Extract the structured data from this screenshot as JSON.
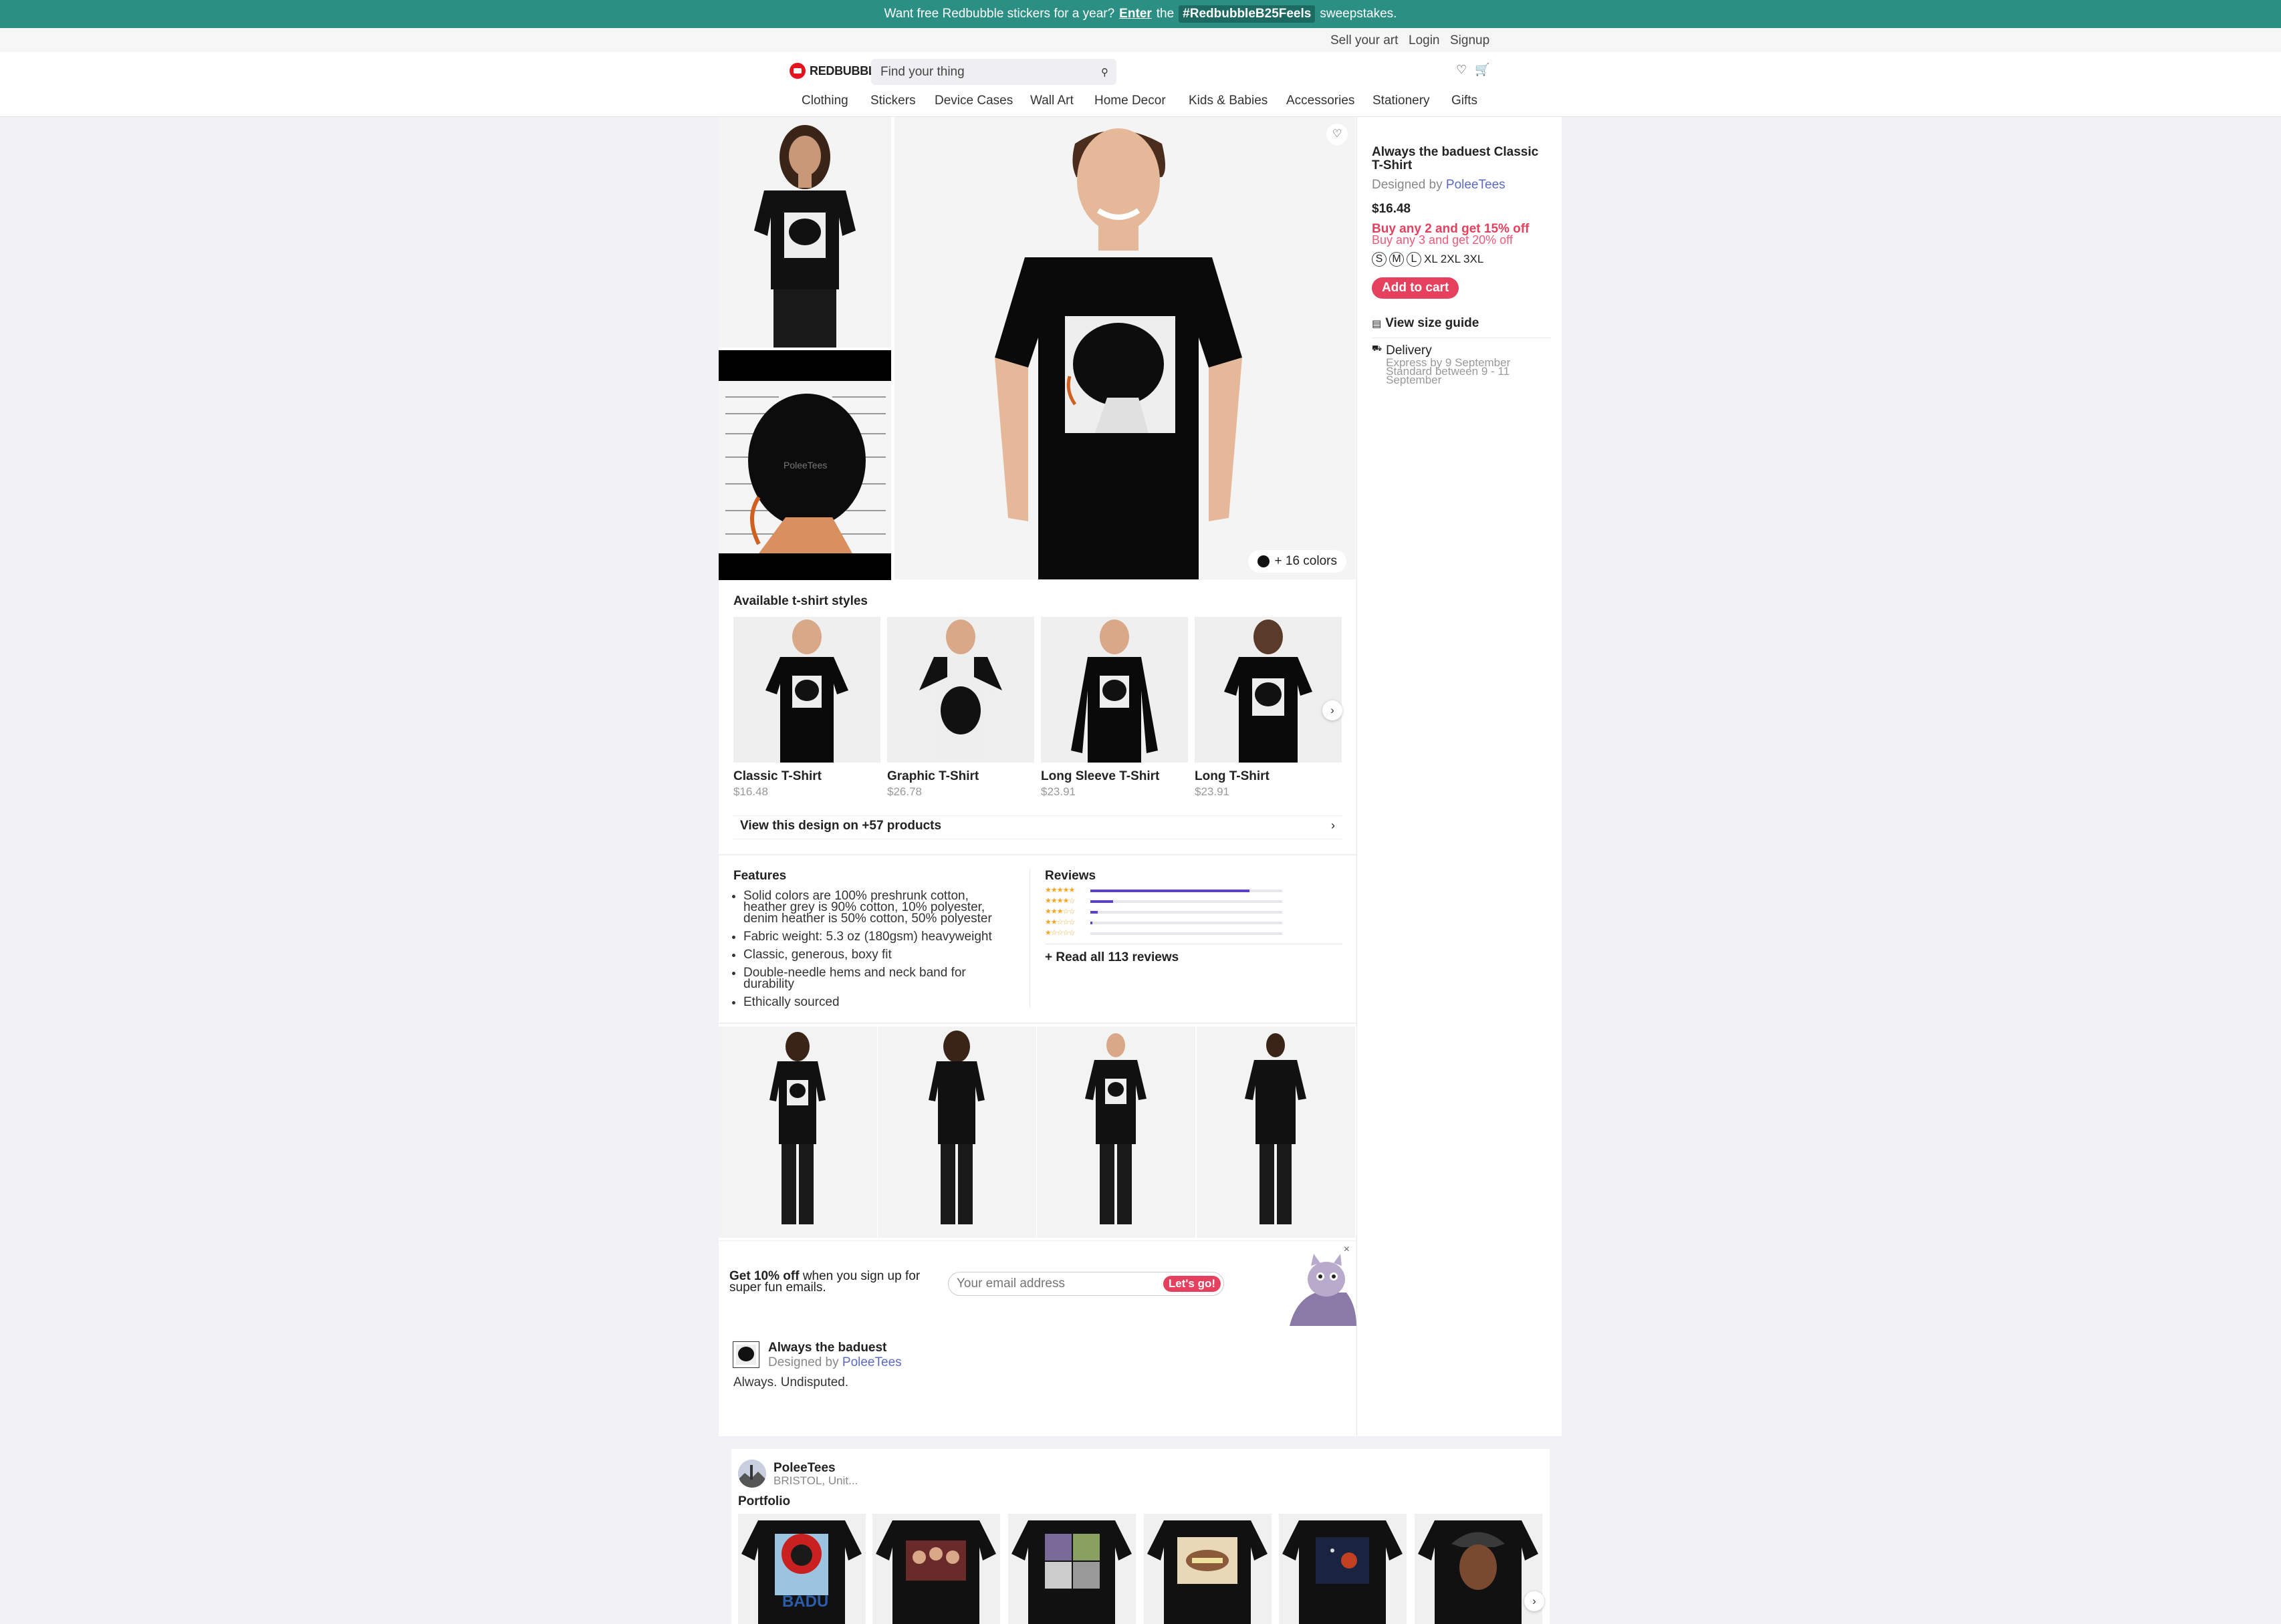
{
  "promo": {
    "pre": "Want free Redbubble stickers for a year?",
    "link": "Enter",
    "mid": "the",
    "tag": "#RedbubbleB25Feels",
    "post": "sweepstakes."
  },
  "util": {
    "sell": "Sell your art",
    "login": "Login",
    "signup": "Signup"
  },
  "header": {
    "logo": "REDBUBBLE",
    "search_placeholder": "Find your thing"
  },
  "nav": [
    "Clothing",
    "Stickers",
    "Device Cases",
    "Wall Art",
    "Home Decor",
    "Kids & Babies",
    "Accessories",
    "Stationery",
    "Gifts"
  ],
  "product": {
    "title": "Always the baduest Classic T-Shirt",
    "designed_by_prefix": "Designed by",
    "designer": "PoleeTees",
    "price": "$16.48",
    "promo1": "Buy any 2 and get 15% off",
    "promo2": "Buy any 3 and get 20% off",
    "sizes": [
      "S",
      "M",
      "L",
      "XL",
      "2XL",
      "3XL"
    ],
    "add_to_cart": "Add to cart",
    "size_guide": "View size guide",
    "delivery_title": "Delivery",
    "delivery_express": "Express by 9 September",
    "delivery_standard": "Standard between 9 - 11 September",
    "colors_label": "+ 16 colors",
    "watermark": "PoleeTees"
  },
  "styles": {
    "title": "Available t-shirt styles",
    "items": [
      {
        "name": "Classic T-Shirt",
        "price": "$16.48"
      },
      {
        "name": "Graphic T-Shirt",
        "price": "$26.78"
      },
      {
        "name": "Long Sleeve T-Shirt",
        "price": "$23.91"
      },
      {
        "name": "Long T-Shirt",
        "price": "$23.91"
      }
    ],
    "view_all": "View this design on +57 products"
  },
  "features": {
    "title": "Features",
    "items": [
      "Solid colors are 100% preshrunk cotton, heather grey is 90% cotton, 10% polyester, denim heather is 50% cotton, 50% polyester",
      "Fabric weight: 5.3 oz (180gsm) heavyweight",
      "Classic, generous, boxy fit",
      "Double-needle hems and neck band for durability",
      "Ethically sourced"
    ]
  },
  "reviews": {
    "title": "Reviews",
    "read_all": "+ Read all 113 reviews",
    "distribution": [
      0.83,
      0.12,
      0.04,
      0.01,
      0.0
    ],
    "star_labels": [
      "★★★★★",
      "★★★★☆",
      "★★★☆☆",
      "★★☆☆☆",
      "★☆☆☆☆"
    ]
  },
  "newsletter": {
    "bold": "Get 10% off",
    "text": "when you sign up for super fun emails.",
    "placeholder": "Your email address",
    "button": "Let's go!",
    "close": "×"
  },
  "design": {
    "title": "Always the baduest",
    "designed_by_prefix": "Designed by",
    "designer": "PoleeTees",
    "description": "Always. Undisputed."
  },
  "artist": {
    "name": "PoleeTees",
    "location": "BRISTOL, Unit...",
    "portfolio": "Portfolio",
    "first_item_text": "BADU"
  },
  "colors": {
    "accent": "#e5405e",
    "promo_bar": "#2b8f83",
    "rating_bar": "#5b3fd3",
    "link": "#5c6ac4"
  }
}
